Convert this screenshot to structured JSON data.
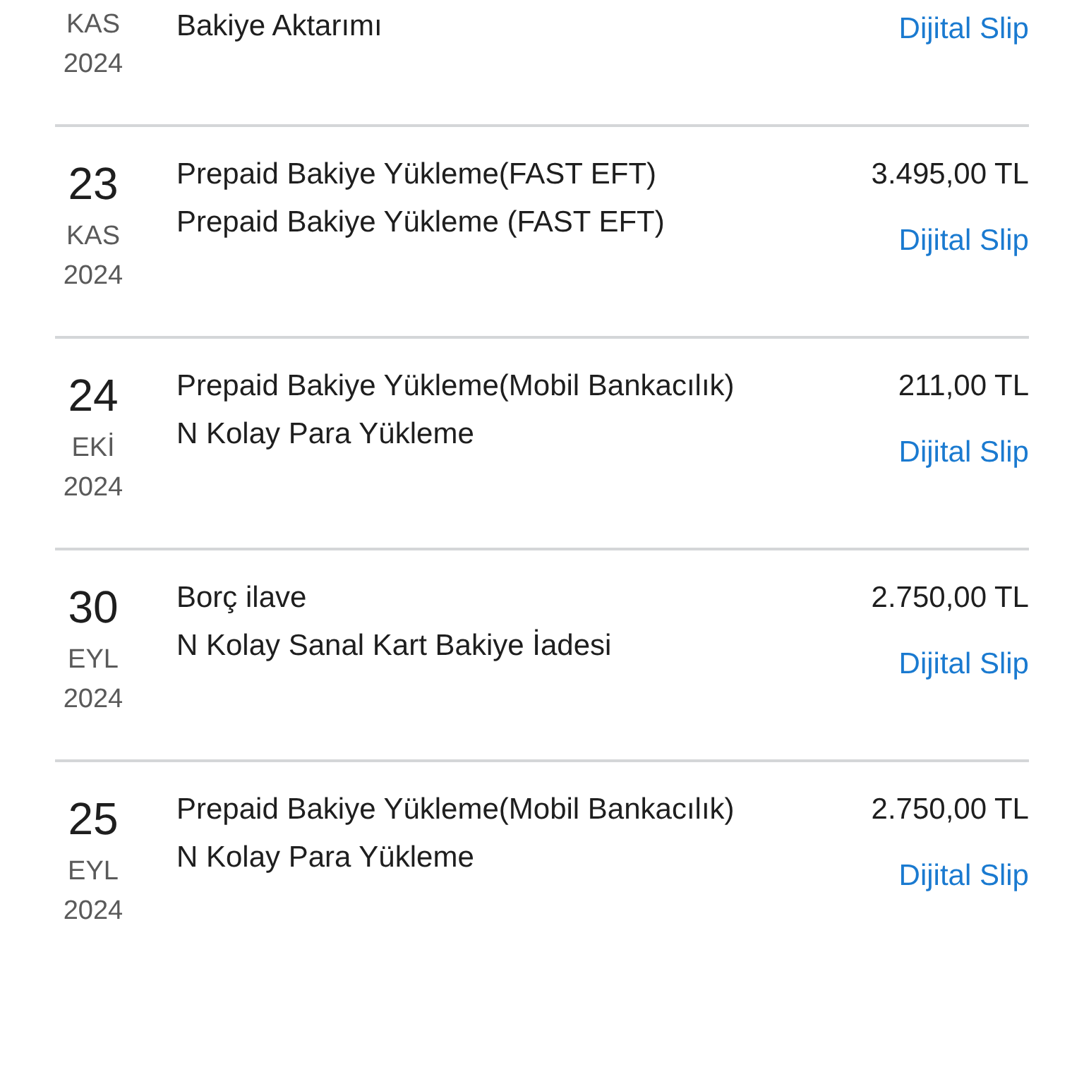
{
  "transactions": [
    {
      "kind": "cut",
      "month": "KAS",
      "year": "2024",
      "lines": [
        "Bakiye Aktarımı"
      ],
      "slip": "Dijital Slip"
    },
    {
      "kind": "full",
      "day": "23",
      "month": "KAS",
      "year": "2024",
      "lines": [
        "Prepaid Bakiye Yükleme(FAST EFT)",
        "Prepaid Bakiye Yükleme (FAST EFT)"
      ],
      "amount": "3.495,00 TL",
      "slip": "Dijital Slip"
    },
    {
      "kind": "full",
      "day": "24",
      "month": "EKİ",
      "year": "2024",
      "lines": [
        "Prepaid Bakiye Yükleme(Mobil Bankacılık)",
        "N Kolay Para Yükleme"
      ],
      "amount": "211,00 TL",
      "slip": "Dijital Slip"
    },
    {
      "kind": "full",
      "day": "30",
      "month": "EYL",
      "year": "2024",
      "lines": [
        "Borç ilave",
        "N Kolay Sanal Kart Bakiye İadesi"
      ],
      "amount": "2.750,00 TL",
      "slip": "Dijital Slip"
    },
    {
      "kind": "full",
      "day": "25",
      "month": "EYL",
      "year": "2024",
      "lines": [
        "Prepaid Bakiye Yükleme(Mobil Bankacılık)",
        "N Kolay Para Yükleme"
      ],
      "amount": "2.750,00 TL",
      "slip": "Dijital Slip"
    }
  ]
}
